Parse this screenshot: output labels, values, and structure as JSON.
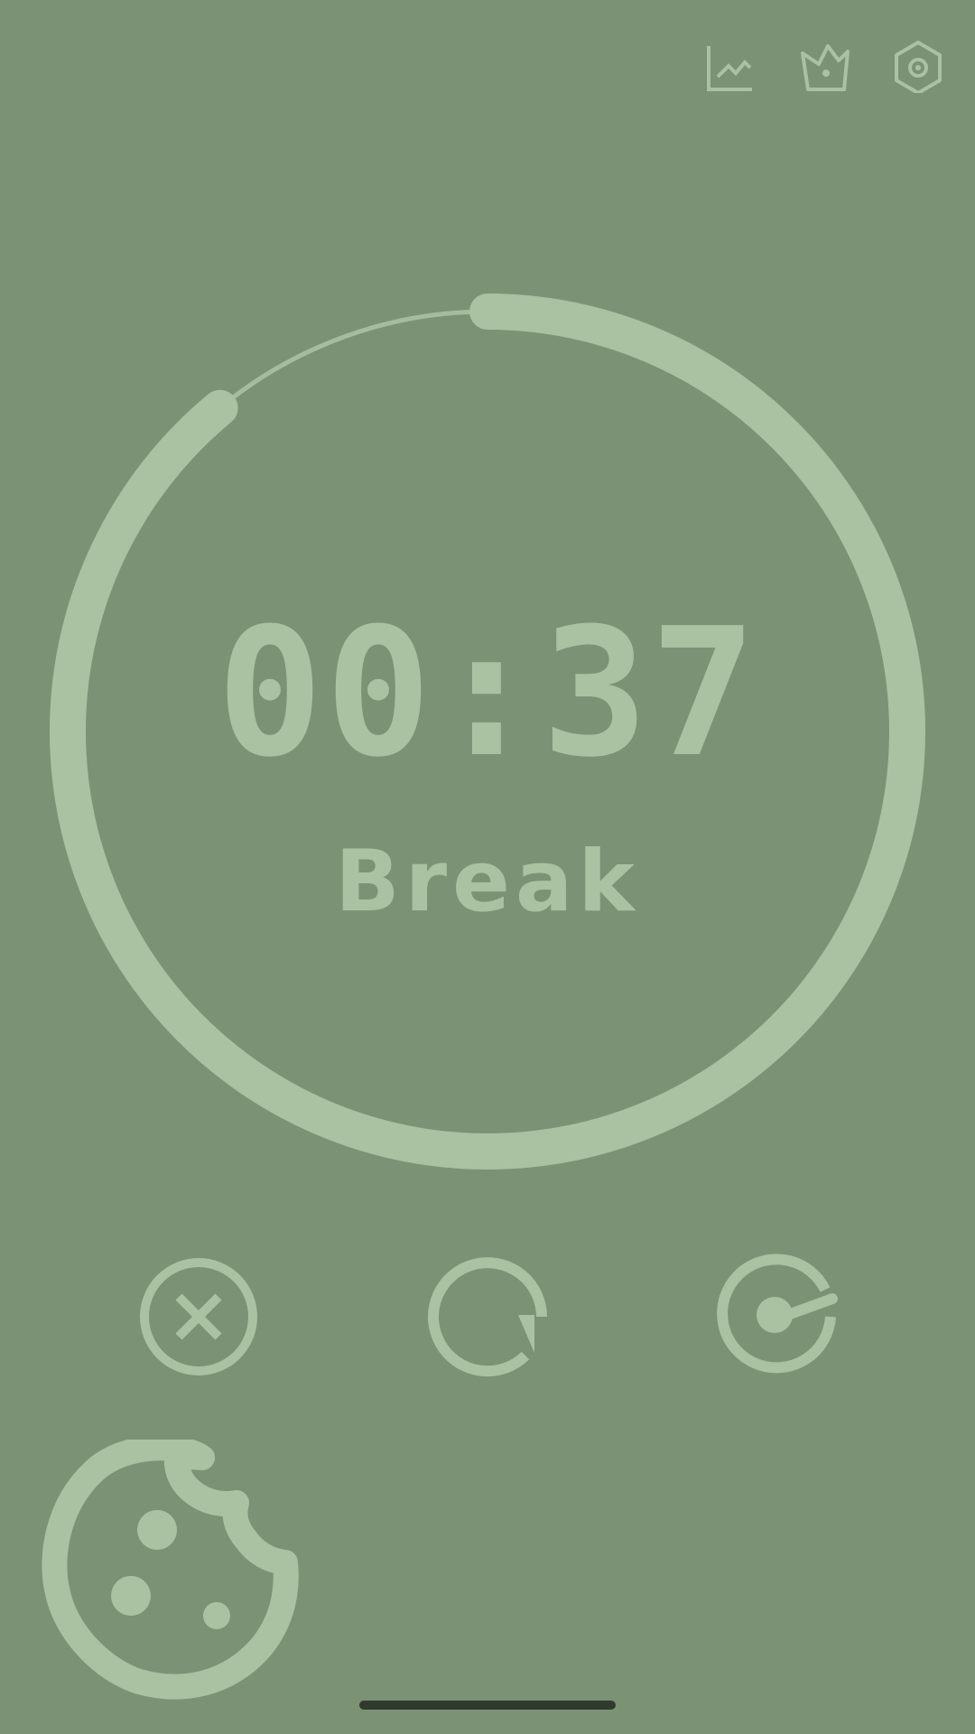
{
  "timer": {
    "time": "00:37",
    "mode": "Break",
    "progress": 0.89
  },
  "toolbar": {
    "icons": [
      "stats-icon",
      "crown-icon",
      "settings-icon"
    ]
  },
  "controls": {
    "icons": [
      "stop-icon",
      "restart-icon",
      "skip-icon"
    ]
  },
  "colors": {
    "background": "#7b9274",
    "accent": "#abc2a2",
    "home_indicator": "#2f3b2c"
  }
}
